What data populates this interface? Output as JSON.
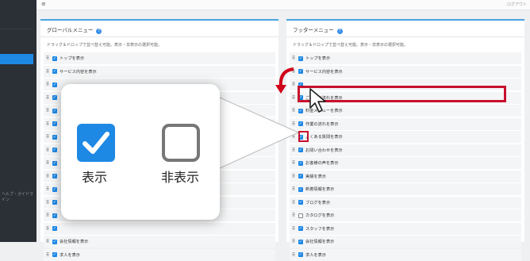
{
  "topbar": {
    "menu_icon": "menu-icon",
    "logout_text": "ログアウト"
  },
  "sidebar": {
    "footer_text": "ヘルプ・ガイドライン"
  },
  "left_panel": {
    "title": "グローバルメニュー",
    "description": "ドラッグ＆ドロップで並べ替え可能。表示・非表示の選択可能。",
    "items": [
      {
        "label": "トップを表示",
        "checked": true
      },
      {
        "label": "サービス内容を表示",
        "checked": true
      },
      {
        "label": "",
        "checked": true
      },
      {
        "label": "",
        "checked": true
      },
      {
        "label": "",
        "checked": true
      },
      {
        "label": "",
        "checked": true
      },
      {
        "label": "",
        "checked": true
      },
      {
        "label": "",
        "checked": true
      },
      {
        "label": "",
        "checked": true
      },
      {
        "label": "",
        "checked": true
      },
      {
        "label": "",
        "checked": true
      },
      {
        "label": "",
        "checked": true
      },
      {
        "label": "",
        "checked": true
      },
      {
        "label": "",
        "checked": true
      },
      {
        "label": "会社情報を表示",
        "checked": true
      },
      {
        "label": "求人を表示",
        "checked": true
      }
    ]
  },
  "right_panel": {
    "title": "フッターメニュー",
    "description": "ドラッグ＆ドロップで並べ替え可能。表示・非表示の選択可能。",
    "items": [
      {
        "label": "トップを表示",
        "checked": true
      },
      {
        "label": "サービス内容を表示",
        "checked": true
      },
      {
        "label": "",
        "checked": true
      },
      {
        "label": "ご利用の流れを表示",
        "checked": true
      },
      {
        "label": "料金メニューを表示",
        "checked": true
      },
      {
        "label": "作業の流れを表示",
        "checked": true
      },
      {
        "label": "よくある質問を表示",
        "checked": true
      },
      {
        "label": "お問い合わせを表示",
        "checked": true
      },
      {
        "label": "お客様の声を表示",
        "checked": true
      },
      {
        "label": "実績を表示",
        "checked": true
      },
      {
        "label": "新着情報を表示",
        "checked": true
      },
      {
        "label": "ブログを表示",
        "checked": true
      },
      {
        "label": "カタログを表示",
        "checked": false
      },
      {
        "label": "スタッフを表示",
        "checked": true
      },
      {
        "label": "会社情報を表示",
        "checked": true
      },
      {
        "label": "求人を表示",
        "checked": true
      }
    ]
  },
  "popup": {
    "show_label": "表示",
    "hide_label": "非表示"
  },
  "colors": {
    "accent": "#1e88e5",
    "highlight": "#c8102e",
    "sidebar": "#2b2f36"
  }
}
